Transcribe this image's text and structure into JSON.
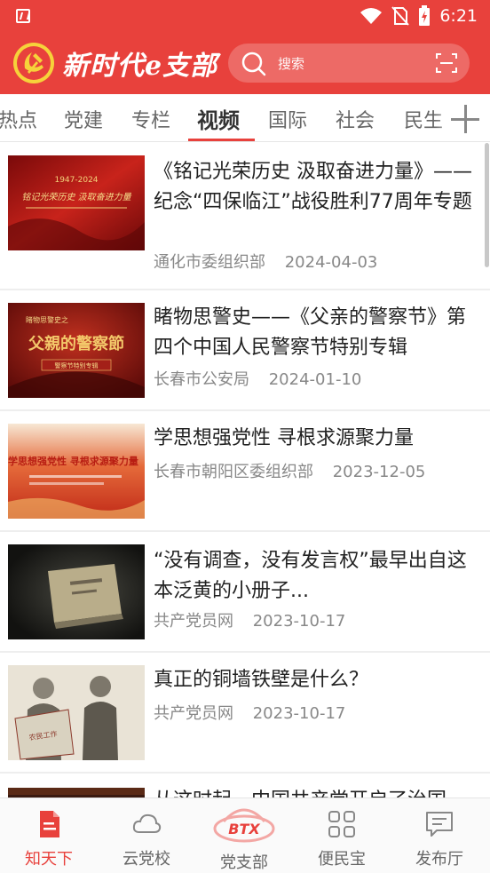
{
  "status_bar": {
    "time": "6:21"
  },
  "header": {
    "brand": "新时代e支部",
    "search_placeholder": "搜索"
  },
  "tabs": [
    {
      "label": "热点"
    },
    {
      "label": "党建"
    },
    {
      "label": "专栏"
    },
    {
      "label": "视频",
      "active": true
    },
    {
      "label": "国际"
    },
    {
      "label": "社会"
    },
    {
      "label": "民生"
    }
  ],
  "articles": [
    {
      "title": "《铭记光荣历史 汲取奋进力量》——纪念“四保临江”战役胜利77周年专题",
      "source": "通化市委组织部",
      "date": "2024-04-03",
      "thumb_text": "铭记光荣历史 汲取奋进力量",
      "thumb_year": "1947-2024"
    },
    {
      "title": "睹物思警史——《父亲的警察节》第四个中国人民警察节特别专辑",
      "source": "长春市公安局",
      "date": "2024-01-10",
      "thumb_small": "睹物思警史之",
      "thumb_text": "父親的警察節",
      "thumb_caption": "警察节特别专辑"
    },
    {
      "title": "学思想强党性 寻根求源聚力量",
      "source": "长春市朝阳区委组织部",
      "date": "2023-12-05",
      "thumb_text": "学思想强党性 寻根求源聚力量"
    },
    {
      "title": "“没有调查，没有发言权”最早出自这本泛黄的小册子...",
      "source": "共产党员网",
      "date": "2023-10-17"
    },
    {
      "title": "真正的铜墙铁壁是什么？",
      "source": "共产党员网",
      "date": "2023-10-17"
    },
    {
      "title": "从这时起，中国共产党开启了治国",
      "source": "",
      "date": ""
    }
  ],
  "bottom_nav": [
    {
      "label": "知天下",
      "icon": "document-icon",
      "active": true
    },
    {
      "label": "云党校",
      "icon": "cloud-icon"
    },
    {
      "label": "党支部",
      "icon": "btx-logo-icon"
    },
    {
      "label": "便民宝",
      "icon": "grid-icon"
    },
    {
      "label": "发布厅",
      "icon": "message-icon"
    }
  ],
  "colors": {
    "brand_red": "#e8413c",
    "text": "#222222",
    "meta": "#888888"
  }
}
